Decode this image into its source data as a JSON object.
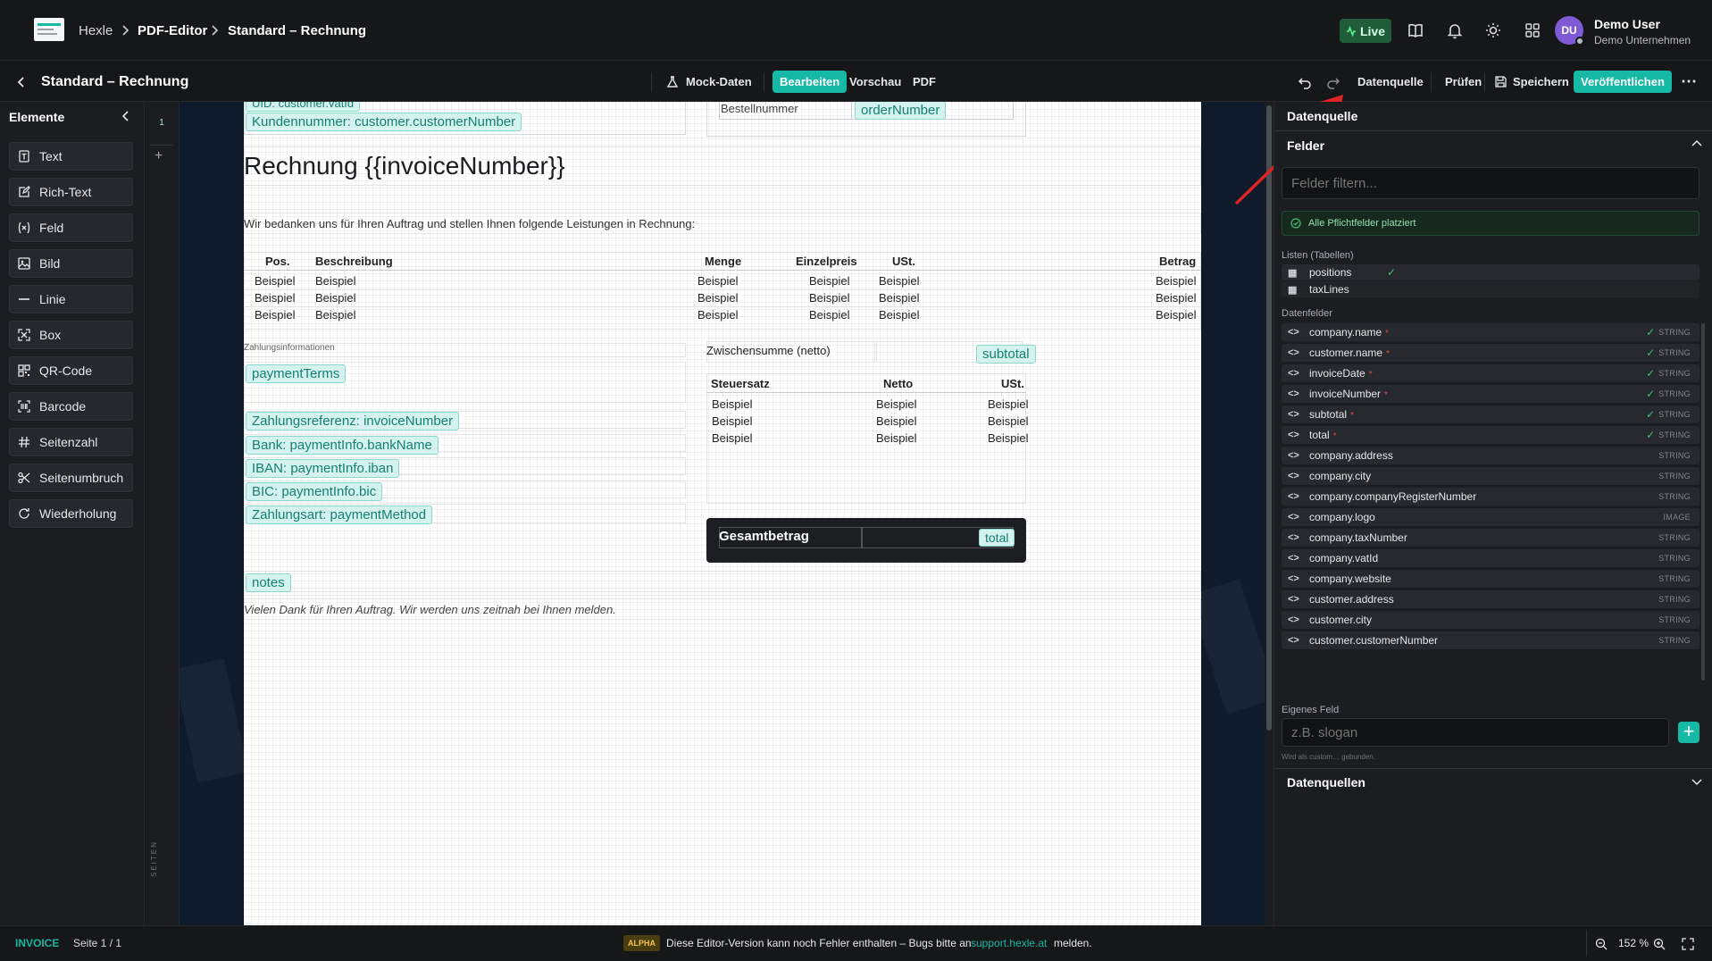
{
  "topbar": {
    "breadcrumb": [
      "Hexle",
      "PDF-Editor",
      "Standard – Rechnung"
    ],
    "live_label": "Live",
    "user": {
      "initials": "DU",
      "name": "Demo User",
      "company": "Demo Unternehmen"
    }
  },
  "toolbar": {
    "back_title": "Standard – Rechnung",
    "mock_label": "Mock-Daten",
    "tabs": [
      "Bearbeiten",
      "Vorschau",
      "PDF"
    ],
    "active_tab": "Bearbeiten",
    "datasource_label": "Datenquelle",
    "check_label": "Prüfen",
    "save_label": "Speichern",
    "publish_label": "Veröffentlichen"
  },
  "left": {
    "title": "Elemente",
    "items": [
      {
        "label": "Text",
        "icon": "text-icon"
      },
      {
        "label": "Rich-Text",
        "icon": "edit-icon"
      },
      {
        "label": "Feld",
        "icon": "variable-icon"
      },
      {
        "label": "Bild",
        "icon": "image-icon"
      },
      {
        "label": "Linie",
        "icon": "line-icon"
      },
      {
        "label": "Box",
        "icon": "box-icon"
      },
      {
        "label": "QR-Code",
        "icon": "qrcode-icon"
      },
      {
        "label": "Barcode",
        "icon": "barcode-icon"
      },
      {
        "label": "Seitenzahl",
        "icon": "hash-icon"
      },
      {
        "label": "Seitenumbruch",
        "icon": "scissors-icon"
      },
      {
        "label": "Wiederholung",
        "icon": "repeat-icon"
      }
    ]
  },
  "pages": {
    "current": "1",
    "vertical_label": "SEITEN"
  },
  "doc": {
    "chip_vat": "UID: customer.vatId",
    "chip_custnum": "Kundennummer: customer.customerNumber",
    "order_label": "Bestellnummer",
    "chip_order": "orderNumber",
    "heading": "Rechnung {{invoiceNumber}}",
    "intro": "Wir bedanken uns für Ihren Auftrag und stellen Ihnen folgende Leistungen in Rechnung:",
    "pos_headers": [
      "Pos.",
      "Beschreibung",
      "Menge",
      "Einzelpreis",
      "USt.",
      "Betrag"
    ],
    "pos_rows": [
      [
        "Beispiel",
        "Beispiel",
        "Beispiel",
        "Beispiel",
        "Beispiel",
        "Beispiel"
      ],
      [
        "Beispiel",
        "Beispiel",
        "Beispiel",
        "Beispiel",
        "Beispiel",
        "Beispiel"
      ],
      [
        "Beispiel",
        "Beispiel",
        "Beispiel",
        "Beispiel",
        "Beispiel",
        "Beispiel"
      ]
    ],
    "payinfo_label": "Zahlungsinformationen",
    "chip_terms": "paymentTerms",
    "chip_ref": "Zahlungsreferenz: invoiceNumber",
    "chip_bank": "Bank: paymentInfo.bankName",
    "chip_iban": "IBAN: paymentInfo.iban",
    "chip_bic": "BIC: paymentInfo.bic",
    "chip_method": "Zahlungsart: paymentMethod",
    "subtotal_label": "Zwischensumme (netto)",
    "chip_subtotal": "subtotal",
    "tax_headers": [
      "Steuersatz",
      "Netto",
      "USt."
    ],
    "tax_rows": [
      [
        "Beispiel",
        "Beispiel",
        "Beispiel"
      ],
      [
        "Beispiel",
        "Beispiel",
        "Beispiel"
      ],
      [
        "Beispiel",
        "Beispiel",
        "Beispiel"
      ]
    ],
    "total_label": "Gesamtbetrag",
    "chip_total": "total",
    "chip_notes": "notes",
    "thanks": "Vielen Dank für Ihren Auftrag. Wir werden uns zeitnah bei Ihnen melden."
  },
  "right": {
    "title": "Datenquelle",
    "fields_title": "Felder",
    "filter_placeholder": "Felder filtern...",
    "required_ok": "Alle Pflichtfelder platziert",
    "lists_label": "Listen (Tabellen)",
    "lists": [
      {
        "name": "positions",
        "ok": true
      },
      {
        "name": "taxLines",
        "ok": false
      }
    ],
    "datafields_label": "Datenfelder",
    "fields": [
      {
        "name": "company.name",
        "req": true,
        "type": "STRING"
      },
      {
        "name": "customer.name",
        "req": true,
        "type": "STRING"
      },
      {
        "name": "invoiceDate",
        "req": true,
        "type": "STRING"
      },
      {
        "name": "invoiceNumber",
        "req": true,
        "type": "STRING"
      },
      {
        "name": "subtotal",
        "req": true,
        "type": "STRING"
      },
      {
        "name": "total",
        "req": true,
        "type": "STRING"
      },
      {
        "name": "company.address",
        "req": false,
        "type": "STRING"
      },
      {
        "name": "company.city",
        "req": false,
        "type": "STRING"
      },
      {
        "name": "company.companyRegisterNumber",
        "req": false,
        "type": "STRING"
      },
      {
        "name": "company.logo",
        "req": false,
        "type": "IMAGE"
      },
      {
        "name": "company.taxNumber",
        "req": false,
        "type": "STRING"
      },
      {
        "name": "company.vatId",
        "req": false,
        "type": "STRING"
      },
      {
        "name": "company.website",
        "req": false,
        "type": "STRING"
      },
      {
        "name": "customer.address",
        "req": false,
        "type": "STRING"
      },
      {
        "name": "customer.city",
        "req": false,
        "type": "STRING"
      },
      {
        "name": "customer.customerNumber",
        "req": false,
        "type": "STRING"
      }
    ],
    "custom_label": "Eigenes Feld",
    "custom_placeholder": "z.B. slogan",
    "custom_hint": "Wird als custom… gebunden.",
    "sources_title": "Datenquellen"
  },
  "status": {
    "doc_type": "INVOICE",
    "page_info": "Seite 1 / 1",
    "alpha": "ALPHA",
    "msg_before": "Diese Editor-Version kann noch Fehler enthalten – Bugs bitte an",
    "msg_link": "support.hexle.at",
    "msg_after": "melden.",
    "zoom": "152 %"
  },
  "colors": {
    "accent": "#16b8a6",
    "live": "#1f5c3a",
    "annotation": "#e02424",
    "required": "#e54848",
    "ok": "#3fbf6f"
  }
}
